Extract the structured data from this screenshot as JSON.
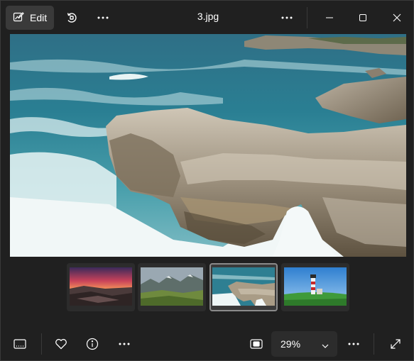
{
  "titlebar": {
    "edit_label": "Edit",
    "file_name": "3.jpg"
  },
  "icons": {
    "edit": "edit-image-icon",
    "rotate": "rotate-icon",
    "more_left": "more-icon",
    "more_right": "more-icon",
    "minimize": "minimize-icon",
    "maximize": "maximize-icon",
    "close": "close-icon",
    "filmstrip_toggle": "filmstrip-icon",
    "favorite": "heart-icon",
    "info": "info-icon",
    "more_bottom": "more-icon",
    "fit": "fit-to-window-icon",
    "zoom_chevron": "chevron-down-icon",
    "more_zoom": "more-icon",
    "fullscreen": "fullscreen-icon"
  },
  "main": {
    "photo_subject": "rocky-coastline-waves"
  },
  "filmstrip": {
    "thumbnails": [
      {
        "subject": "sunset-rocky-shore",
        "selected": false
      },
      {
        "subject": "mountain-valley",
        "selected": false
      },
      {
        "subject": "rocky-coastline-waves",
        "selected": true
      },
      {
        "subject": "lighthouse-meadow",
        "selected": false
      }
    ]
  },
  "bottombar": {
    "zoom_value": "29%"
  },
  "colors": {
    "background": "#202020",
    "control": "#2c2c2c",
    "edit_button": "#3a3a3a",
    "text": "#ffffff"
  }
}
